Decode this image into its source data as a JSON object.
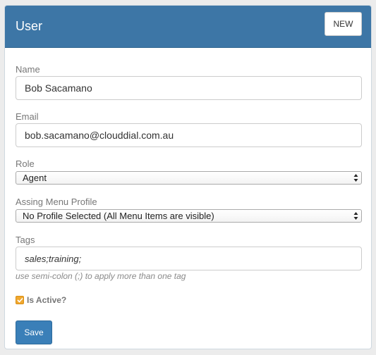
{
  "panel": {
    "title": "User",
    "new_label": "NEW"
  },
  "form": {
    "name": {
      "label": "Name",
      "value": "Bob Sacamano"
    },
    "email": {
      "label": "Email",
      "value": "bob.sacamano@clouddial.com.au"
    },
    "role": {
      "label": "Role",
      "selected": "Agent"
    },
    "menu_profile": {
      "label": "Assing Menu Profile",
      "selected": "No Profile Selected (All Menu Items are visible)"
    },
    "tags": {
      "label": "Tags",
      "value": "sales;training;",
      "help": "use semi-colon (;) to apply more than one tag"
    },
    "active": {
      "label": "Is Active?",
      "checked": true
    },
    "save_label": "Save"
  },
  "colors": {
    "header": "#3d76a6",
    "primary_button": "#3a7fb8",
    "checkbox": "#f0a830"
  }
}
